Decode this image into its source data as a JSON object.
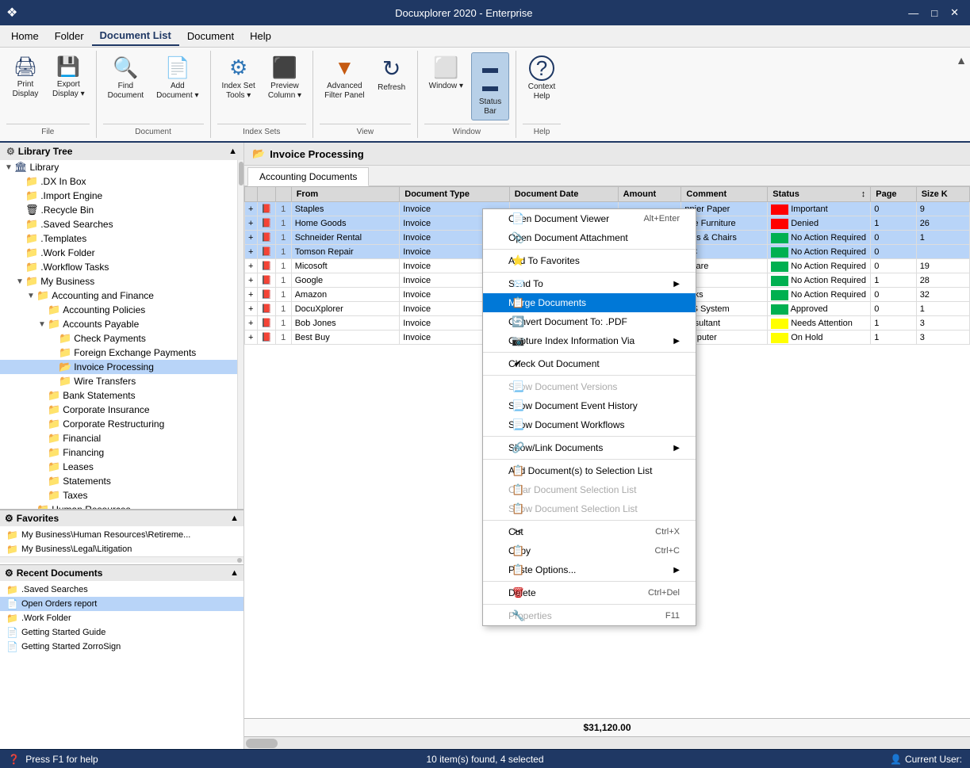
{
  "titleBar": {
    "title": "Docuxplorer 2020 - Enterprise",
    "sysIcon": "❖"
  },
  "menuBar": {
    "items": [
      "Home",
      "Folder",
      "Document List",
      "Document",
      "Help"
    ]
  },
  "ribbon": {
    "groups": [
      {
        "label": "File",
        "buttons": [
          {
            "id": "print-display",
            "label": "Print\nDisplay",
            "icon": "🖨",
            "split": false
          },
          {
            "id": "export-display",
            "label": "Export\nDisplay",
            "icon": "💾",
            "split": true
          }
        ]
      },
      {
        "label": "Document",
        "buttons": [
          {
            "id": "find-document",
            "label": "Find\nDocument",
            "icon": "🔍",
            "split": false
          },
          {
            "id": "add-document",
            "label": "Add\nDocument",
            "icon": "📄",
            "split": true
          }
        ]
      },
      {
        "label": "Index Sets",
        "buttons": [
          {
            "id": "index-set-tools",
            "label": "Index Set\nTools",
            "icon": "⚙",
            "split": true
          },
          {
            "id": "preview-column",
            "label": "Preview\nColumn",
            "icon": "📊",
            "split": true
          }
        ]
      },
      {
        "label": "View",
        "buttons": [
          {
            "id": "advanced-filter",
            "label": "Advanced\nFilter Panel",
            "icon": "▼",
            "split": false
          },
          {
            "id": "refresh",
            "label": "Refresh",
            "icon": "↻",
            "split": false
          }
        ]
      },
      {
        "label": "Window",
        "buttons": [
          {
            "id": "window",
            "label": "Window",
            "icon": "⬜",
            "split": true
          },
          {
            "id": "status-bar",
            "label": "Status\nBar",
            "icon": "▬",
            "split": false,
            "active": true
          }
        ]
      },
      {
        "label": "Help",
        "buttons": [
          {
            "id": "context-help",
            "label": "Context\nHelp",
            "icon": "?",
            "split": false
          }
        ]
      }
    ]
  },
  "sidebar": {
    "header": "Library Tree",
    "tree": [
      {
        "id": "library",
        "label": "Library",
        "level": 0,
        "icon": "🏛",
        "toggle": "▼",
        "type": "root"
      },
      {
        "id": "dx-inbox",
        "label": ".DX In Box",
        "level": 1,
        "icon": "📁",
        "toggle": " "
      },
      {
        "id": "import-engine",
        "label": ".Import Engine",
        "level": 1,
        "icon": "📁",
        "toggle": " "
      },
      {
        "id": "recycle-bin",
        "label": ".Recycle Bin",
        "level": 1,
        "icon": "🗑",
        "toggle": " "
      },
      {
        "id": "saved-searches",
        "label": ".Saved Searches",
        "level": 1,
        "icon": "📁",
        "toggle": " "
      },
      {
        "id": "templates",
        "label": ".Templates",
        "level": 1,
        "icon": "📁",
        "toggle": " "
      },
      {
        "id": "work-folder",
        "label": ".Work Folder",
        "level": 1,
        "icon": "📁",
        "toggle": " "
      },
      {
        "id": "workflow-tasks",
        "label": ".Workflow Tasks",
        "level": 1,
        "icon": "📁",
        "toggle": " "
      },
      {
        "id": "my-business",
        "label": "My Business",
        "level": 1,
        "icon": "📁",
        "toggle": "▼"
      },
      {
        "id": "accounting-finance",
        "label": "Accounting and Finance",
        "level": 2,
        "icon": "📁",
        "toggle": "▼"
      },
      {
        "id": "accounting-policies",
        "label": "Accounting Policies",
        "level": 3,
        "icon": "📁",
        "toggle": " "
      },
      {
        "id": "accounts-payable",
        "label": "Accounts Payable",
        "level": 3,
        "icon": "📁",
        "toggle": "▼"
      },
      {
        "id": "check-payments",
        "label": "Check Payments",
        "level": 4,
        "icon": "📁",
        "toggle": " "
      },
      {
        "id": "foreign-exchange",
        "label": "Foreign Exchange Payments",
        "level": 4,
        "icon": "📁",
        "toggle": " "
      },
      {
        "id": "invoice-processing",
        "label": "Invoice Processing",
        "level": 4,
        "icon": "📂",
        "toggle": " ",
        "selected": true
      },
      {
        "id": "wire-transfers",
        "label": "Wire Transfers",
        "level": 4,
        "icon": "📁",
        "toggle": " "
      },
      {
        "id": "bank-statements",
        "label": "Bank Statements",
        "level": 3,
        "icon": "📁",
        "toggle": " "
      },
      {
        "id": "corporate-insurance",
        "label": "Corporate Insurance",
        "level": 3,
        "icon": "📁",
        "toggle": " "
      },
      {
        "id": "corporate-restructuring",
        "label": "Corporate Restructuring",
        "level": 3,
        "icon": "📁",
        "toggle": " "
      },
      {
        "id": "financial",
        "label": "Financial",
        "level": 3,
        "icon": "📁",
        "toggle": " "
      },
      {
        "id": "financing",
        "label": "Financing",
        "level": 3,
        "icon": "📁",
        "toggle": " "
      },
      {
        "id": "leases",
        "label": "Leases",
        "level": 3,
        "icon": "📁",
        "toggle": " "
      },
      {
        "id": "statements",
        "label": "Statements",
        "level": 3,
        "icon": "📁",
        "toggle": " "
      },
      {
        "id": "taxes",
        "label": "Taxes",
        "level": 3,
        "icon": "📁",
        "toggle": " "
      },
      {
        "id": "human-resources",
        "label": "Human Resources",
        "level": 2,
        "icon": "📁",
        "toggle": " "
      }
    ],
    "favorites": {
      "header": "Favorites",
      "items": [
        {
          "id": "fav-1",
          "label": "My Business\\Human Resources\\Retireme...",
          "icon": "📁"
        },
        {
          "id": "fav-2",
          "label": "My Business\\Legal\\Litigation",
          "icon": "📁"
        }
      ]
    },
    "recentDocs": {
      "header": "Recent Documents",
      "items": [
        {
          "id": "rd-1",
          "label": ".Saved Searches",
          "icon": "📁"
        },
        {
          "id": "rd-2",
          "label": "Open Orders report",
          "icon": "📄",
          "selected": true
        },
        {
          "id": "rd-3",
          "label": ".Work Folder",
          "icon": "📁"
        },
        {
          "id": "rd-4",
          "label": "Getting Started Guide",
          "icon": "📄"
        },
        {
          "id": "rd-5",
          "label": "Getting Started ZorroSign",
          "icon": "📄"
        }
      ]
    }
  },
  "docPanel": {
    "folderIcon": "📂",
    "title": "Invoice Processing",
    "tabs": [
      "Accounting Documents"
    ],
    "columns": [
      "",
      "",
      "",
      "From",
      "Document Type",
      "Document Date",
      "Amount",
      "Comment",
      "Status",
      "Page",
      "Size K"
    ],
    "rows": [
      {
        "id": 1,
        "num": "1",
        "from": "Staples",
        "type": "Invoice",
        "date": "",
        "amount": "",
        "comment": "ppier Paper",
        "status": "Important",
        "statusColor": "red",
        "pages": "0",
        "size": "9",
        "selected": true
      },
      {
        "id": 2,
        "num": "1",
        "from": "Home Goods",
        "type": "Invoice",
        "date": "",
        "amount": "",
        "comment": "fice Furniture",
        "status": "Denied",
        "statusColor": "red",
        "pages": "1",
        "size": "26",
        "selected": true
      },
      {
        "id": 3,
        "num": "1",
        "from": "Schneider Rental",
        "type": "Invoice",
        "date": "",
        "amount": "",
        "comment": "bles & Chairs",
        "status": "No Action Required",
        "statusColor": "green",
        "pages": "0",
        "size": "1",
        "selected": true
      },
      {
        "id": 4,
        "num": "1",
        "from": "Tomson Repair",
        "type": "Invoice",
        "date": "",
        "amount": "",
        "comment": "HC",
        "status": "No Action Required",
        "statusColor": "green",
        "pages": "0",
        "size": "",
        "selected": true
      },
      {
        "id": 5,
        "num": "1",
        "from": "Micosoft",
        "type": "Invoice",
        "date": "",
        "amount": "",
        "comment": "ftware",
        "status": "No Action Required",
        "statusColor": "green",
        "pages": "0",
        "size": "19",
        "selected": false
      },
      {
        "id": 6,
        "num": "1",
        "from": "Google",
        "type": "Invoice",
        "date": "",
        "amount": "",
        "comment": "les",
        "status": "No Action Required",
        "statusColor": "green",
        "pages": "1",
        "size": "28",
        "selected": false
      },
      {
        "id": 7,
        "num": "1",
        "from": "Amazon",
        "type": "Invoice",
        "date": "",
        "amount": "",
        "comment": "ooks",
        "status": "No Action Required",
        "statusColor": "green",
        "pages": "0",
        "size": "32",
        "selected": false
      },
      {
        "id": 8,
        "num": "1",
        "from": "DocuXplorer",
        "type": "Invoice",
        "date": "",
        "amount": "",
        "comment": "MS System",
        "status": "Approved",
        "statusColor": "green",
        "pages": "0",
        "size": "1",
        "selected": false
      },
      {
        "id": 9,
        "num": "1",
        "from": "Bob Jones",
        "type": "Invoice",
        "date": "",
        "amount": "",
        "comment": "onsultant",
        "status": "Needs Attention",
        "statusColor": "yellow",
        "pages": "1",
        "size": "3",
        "selected": false
      },
      {
        "id": 10,
        "num": "1",
        "from": "Best Buy",
        "type": "Invoice",
        "date": "",
        "amount": "",
        "comment": "omputer",
        "status": "On Hold",
        "statusColor": "yellow",
        "pages": "1",
        "size": "3",
        "selected": false
      }
    ],
    "footer": {
      "total": "$31,120.00"
    }
  },
  "contextMenu": {
    "items": [
      {
        "id": "open-viewer",
        "label": "Open Document Viewer",
        "shortcut": "Alt+Enter",
        "icon": "📄",
        "type": "item"
      },
      {
        "id": "open-attachment",
        "label": "Open Document Attachment",
        "shortcut": "",
        "icon": "📎",
        "type": "item"
      },
      {
        "id": "sep1",
        "type": "separator"
      },
      {
        "id": "add-favorites",
        "label": "Add To Favorites",
        "shortcut": "",
        "icon": "⭐",
        "type": "item"
      },
      {
        "id": "sep2",
        "type": "separator"
      },
      {
        "id": "send-to",
        "label": "Send To",
        "shortcut": "",
        "icon": "📨",
        "type": "item",
        "hasArrow": true
      },
      {
        "id": "merge-docs",
        "label": "Merge Documents",
        "shortcut": "",
        "icon": "📋",
        "type": "item",
        "active": true
      },
      {
        "id": "convert-doc",
        "label": "Convert Document To: .PDF",
        "shortcut": "",
        "icon": "🔄",
        "type": "item"
      },
      {
        "id": "capture-index",
        "label": "Capture Index Information Via",
        "shortcut": "",
        "icon": "📷",
        "type": "item",
        "hasArrow": true
      },
      {
        "id": "sep3",
        "type": "separator"
      },
      {
        "id": "checkout",
        "label": "Check Out Document",
        "shortcut": "",
        "icon": "✔",
        "type": "item"
      },
      {
        "id": "sep4",
        "type": "separator"
      },
      {
        "id": "show-versions",
        "label": "Show Document Versions",
        "shortcut": "",
        "icon": "📃",
        "type": "item",
        "disabled": true
      },
      {
        "id": "show-events",
        "label": "Show Document Event History",
        "shortcut": "",
        "icon": "📃",
        "type": "item"
      },
      {
        "id": "show-workflows",
        "label": "Show Document Workflows",
        "shortcut": "",
        "icon": "📃",
        "type": "item"
      },
      {
        "id": "sep5",
        "type": "separator"
      },
      {
        "id": "show-link",
        "label": "Show/Link Documents",
        "shortcut": "",
        "icon": "🔗",
        "type": "item",
        "hasArrow": true
      },
      {
        "id": "sep6",
        "type": "separator"
      },
      {
        "id": "add-selection",
        "label": "Add Document(s) to Selection List",
        "shortcut": "",
        "icon": "📋",
        "type": "item"
      },
      {
        "id": "clear-selection",
        "label": "Clear Document Selection List",
        "shortcut": "",
        "icon": "📋",
        "type": "item",
        "disabled": true
      },
      {
        "id": "show-selection",
        "label": "Show Document Selection List",
        "shortcut": "",
        "icon": "📋",
        "type": "item",
        "disabled": true
      },
      {
        "id": "sep7",
        "type": "separator"
      },
      {
        "id": "cut",
        "label": "Cut",
        "shortcut": "Ctrl+X",
        "icon": "✂",
        "type": "item"
      },
      {
        "id": "copy",
        "label": "Copy",
        "shortcut": "Ctrl+C",
        "icon": "📋",
        "type": "item"
      },
      {
        "id": "paste",
        "label": "Paste Options...",
        "shortcut": "",
        "icon": "📋",
        "type": "item",
        "hasArrow": true
      },
      {
        "id": "sep8",
        "type": "separator"
      },
      {
        "id": "delete",
        "label": "Delete",
        "shortcut": "Ctrl+Del",
        "icon": "🗑",
        "type": "item"
      },
      {
        "id": "sep9",
        "type": "separator"
      },
      {
        "id": "properties",
        "label": "Properties",
        "shortcut": "F11",
        "icon": "🔧",
        "type": "item",
        "disabled": true
      }
    ]
  },
  "statusBar": {
    "leftText": "Press F1 for help",
    "centerText": "10 item(s) found, 4 selected",
    "rightText": "Current User:"
  }
}
